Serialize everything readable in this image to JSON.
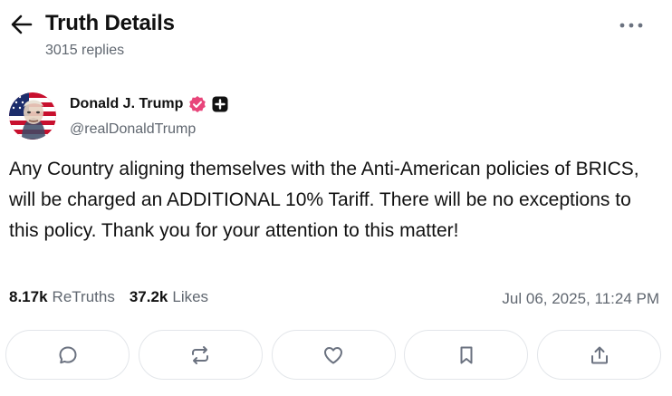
{
  "header": {
    "title": "Truth Details",
    "replies": "3015 replies",
    "back_icon": "arrow-left-icon",
    "more_icon": "ellipsis-icon"
  },
  "author": {
    "display_name": "Donald J. Trump",
    "handle": "@realDonaldTrump",
    "verified_icon": "verified-badge-icon",
    "verified_color": "#e8457a",
    "plus_icon": "plus-badge-icon"
  },
  "post": {
    "text": "Any Country aligning themselves with the Anti-American policies of BRICS, will be charged an ADDITIONAL 10% Tariff. There will be no exceptions to this policy. Thank you for your attention to this matter!"
  },
  "stats": {
    "retruths_count": "8.17k",
    "retruths_label": "ReTruths",
    "likes_count": "37.2k",
    "likes_label": "Likes",
    "timestamp": "Jul 06, 2025, 11:24 PM"
  },
  "actions": [
    {
      "name": "reply",
      "icon": "comment-icon"
    },
    {
      "name": "retruth",
      "icon": "repost-icon"
    },
    {
      "name": "like",
      "icon": "heart-icon"
    },
    {
      "name": "bookmark",
      "icon": "bookmark-icon"
    },
    {
      "name": "share",
      "icon": "share-icon"
    }
  ],
  "colors": {
    "text_primary": "#111111",
    "text_secondary": "#606770",
    "icon_gray": "#6b7280",
    "border": "#e3e6ea"
  }
}
